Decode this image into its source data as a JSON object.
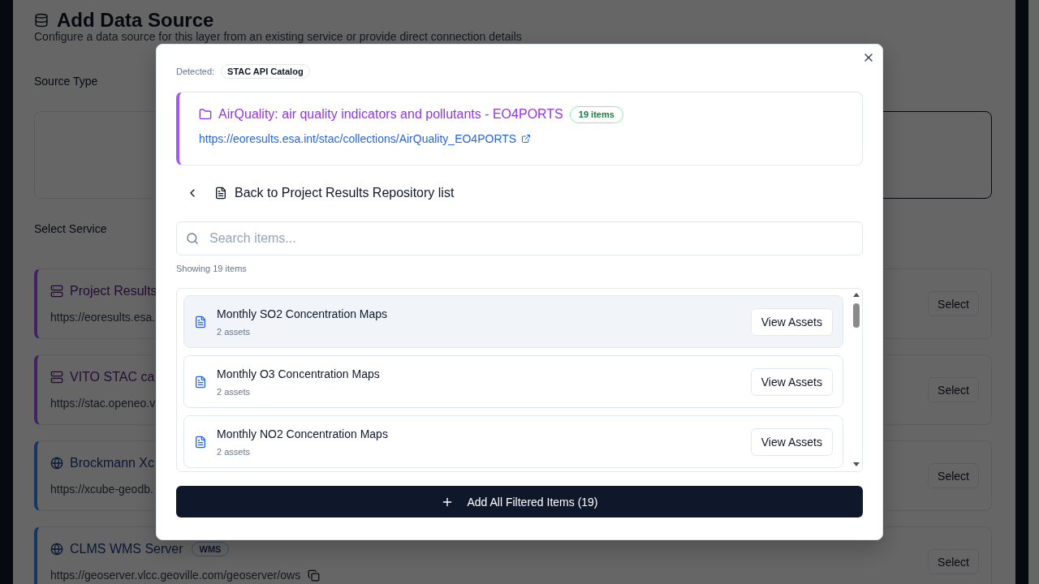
{
  "page": {
    "title": "Add Data Source",
    "subtitle": "Configure a data source for this layer from an existing service or provide direct connection details",
    "source_type": {
      "label": "Source Type",
      "options": [
        {
          "selected": false
        },
        {
          "selected": true
        }
      ]
    },
    "select_service": {
      "label": "Select Service",
      "services": [
        {
          "kind": "catalog",
          "title": "Project Results",
          "url": "https://eoresults.esa.",
          "copyable": false,
          "action": "Select"
        },
        {
          "kind": "catalog",
          "title": "VITO STAC ca",
          "url": "https://stac.openeo.v",
          "copyable": false,
          "action": "Select"
        },
        {
          "kind": "service",
          "title": "Brockmann Xc",
          "url": "https://xcube-geodb.",
          "copyable": false,
          "action": "Select"
        },
        {
          "kind": "service",
          "title": "CLMS WMS Server",
          "badge": "WMS",
          "url": "https://geoserver.vlcc.geoville.com/geoserver/ows",
          "copyable": true,
          "action": "Select"
        }
      ]
    }
  },
  "dialog": {
    "detected_label": "Detected:",
    "detected_type": "STAC API Catalog",
    "collection": {
      "title": "AirQuality: air quality indicators and pollutants - EO4PORTS",
      "count": "19 items",
      "url": "https://eoresults.esa.int/stac/collections/AirQuality_EO4PORTS"
    },
    "breadcrumb": "Back to Project Results Repository list",
    "search": {
      "placeholder": "Search items..."
    },
    "result_count": "Showing 19 items",
    "items": [
      {
        "title": "Monthly SO2 Concentration Maps",
        "assets": "2 assets",
        "highlighted": true,
        "action": "View Assets"
      },
      {
        "title": "Monthly O3 Concentration Maps",
        "assets": "2 assets",
        "highlighted": false,
        "action": "View Assets"
      },
      {
        "title": "Monthly NO2 Concentration Maps",
        "assets": "2 assets",
        "highlighted": false,
        "action": "View Assets"
      }
    ],
    "add_button": "Add All Filtered Items (19)"
  }
}
